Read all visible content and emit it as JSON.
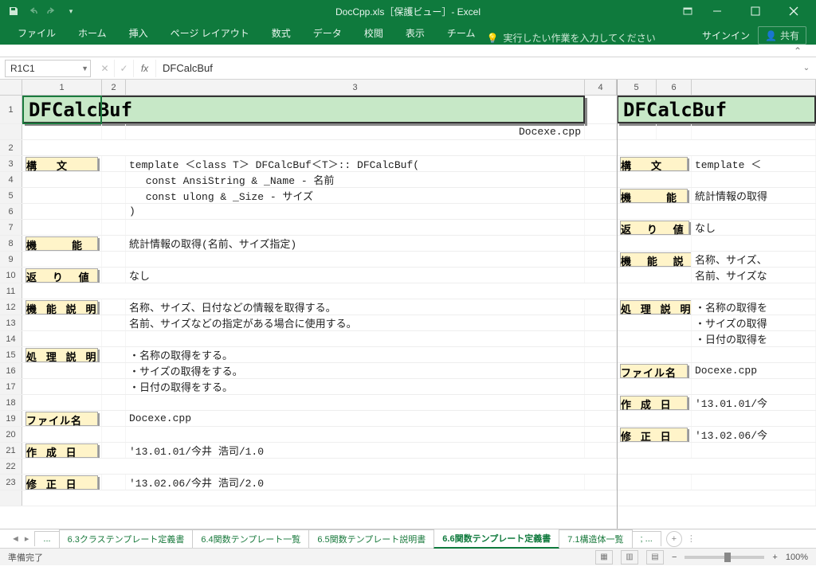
{
  "title": "DocCpp.xls［保護ビュー］- Excel",
  "ribbon": {
    "tabs": [
      "ファイル",
      "ホーム",
      "挿入",
      "ページ レイアウト",
      "数式",
      "データ",
      "校閲",
      "表示",
      "チーム"
    ],
    "tell_me": "実行したい作業を入力してください",
    "sign_in": "サインイン",
    "share": "共有"
  },
  "name_box": "R1C1",
  "formula": "DFCalcBuf",
  "columns": [
    "1",
    "2",
    "3",
    "4",
    "5",
    "6"
  ],
  "left": {
    "title": "DFCalcBuf",
    "file_hint": "Docexe.cpp",
    "syntax_label": "構　文",
    "syntax_lines": [
      "template ＜class T＞ DFCalcBuf＜T＞:: DFCalcBuf(",
      "　 const AnsiString & _Name  - 名前",
      "　 const ulong &      _Size  - サイズ",
      ")"
    ],
    "func_label": "機　　能",
    "func_text": "統計情報の取得(名前、サイズ指定)",
    "ret_label": "返 り 値",
    "ret_text": "なし",
    "desc_label": "機 能 説 明",
    "desc_lines": [
      "名称、サイズ、日付などの情報を取得する。",
      "名前、サイズなどの指定がある場合に使用する。"
    ],
    "proc_label": "処 理 説 明",
    "proc_lines": [
      "・名称の取得をする。",
      "・サイズの取得をする。",
      "・日付の取得をする。"
    ],
    "filename_label": "ファイル名",
    "filename": "Docexe.cpp",
    "created_label": "作 成 日",
    "created": "'13.01.01/今井 浩司/1.0",
    "modified_label": "修 正 日",
    "modified": "'13.02.06/今井 浩司/2.0"
  },
  "right": {
    "title": "DFCalcBuf",
    "syntax_label": "構　文",
    "syntax_text": "template ＜",
    "func_label": "機　　能",
    "func_text": "統計情報の取得",
    "ret_label": "返 り 値",
    "ret_text": "なし",
    "desc_label": "機 能 説 明",
    "desc_lines": [
      "名称、サイズ、",
      "名前、サイズな"
    ],
    "proc_label": "処 理 説 明",
    "proc_lines": [
      "・名称の取得を",
      "・サイズの取得",
      "・日付の取得を"
    ],
    "filename_label": "ファイル名",
    "filename": "Docexe.cpp",
    "created_label": "作 成 日",
    "created": "'13.01.01/今",
    "modified_label": "修 正 日",
    "modified": "'13.02.06/今"
  },
  "sheets": {
    "overflow_left": "...",
    "tabs": [
      "6.3クラステンプレート定義書",
      "6.4関数テンプレート一覧",
      "6.5関数テンプレート説明書",
      "6.6関数テンプレート定義書",
      "7.1構造体一覧"
    ],
    "overflow_right": "; ...",
    "active": 3
  },
  "status": {
    "ready": "準備完了",
    "zoom": "100%"
  }
}
